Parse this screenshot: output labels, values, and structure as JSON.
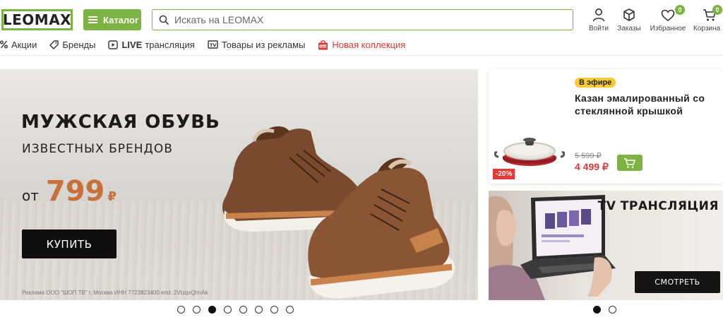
{
  "header": {
    "logo": "LEOMAX",
    "catalog_label": "Каталог",
    "search_placeholder": "Искать на LEOMAX",
    "actions": {
      "login": "Войти",
      "orders": "Заказы",
      "favorites": "Избранное",
      "favorites_count": "0",
      "cart": "Корзина",
      "cart_count": "0"
    }
  },
  "nav": {
    "items": [
      {
        "label": "Акции",
        "icon": "percent-icon"
      },
      {
        "label": "Бренды",
        "icon": "tag-icon"
      },
      {
        "label_bold": "LIVE",
        "label": "трансляция",
        "icon": "play-icon"
      },
      {
        "label": "Товары из рекламы",
        "icon": "tv-icon"
      },
      {
        "label": "Новая коллекция",
        "icon": "sale-bag-icon"
      }
    ]
  },
  "hero": {
    "title": "МУЖСКАЯ ОБУВЬ",
    "subtitle": "ИЗВЕСТНЫХ БРЕНДОВ",
    "price_prefix": "от",
    "price": "799",
    "currency": "₽",
    "buy_label": "КУПИТЬ",
    "disclaimer": "Реклама ООО \"ШОП ТВ\" г. Москва ИНН 7723823400 erid: 2VtzqxQhnAk",
    "slides_count": 8,
    "active_slide": 3
  },
  "product_card": {
    "badge": "В эфире",
    "title": "Казан эмалированный со стеклянной крышкой",
    "old_price": "5 599 ₽",
    "new_price": "4 499 ₽",
    "discount": "-20%"
  },
  "tv_banner": {
    "title": "TV ТРАНСЛЯЦИЯ",
    "watch_label": "СМОТРЕТЬ",
    "slides_count": 2,
    "active_slide": 1
  },
  "colors": {
    "brand_green": "#7cb342",
    "accent_red": "#d93a3a",
    "price_orange": "#c8703a",
    "on_air_yellow": "#f7c934"
  }
}
